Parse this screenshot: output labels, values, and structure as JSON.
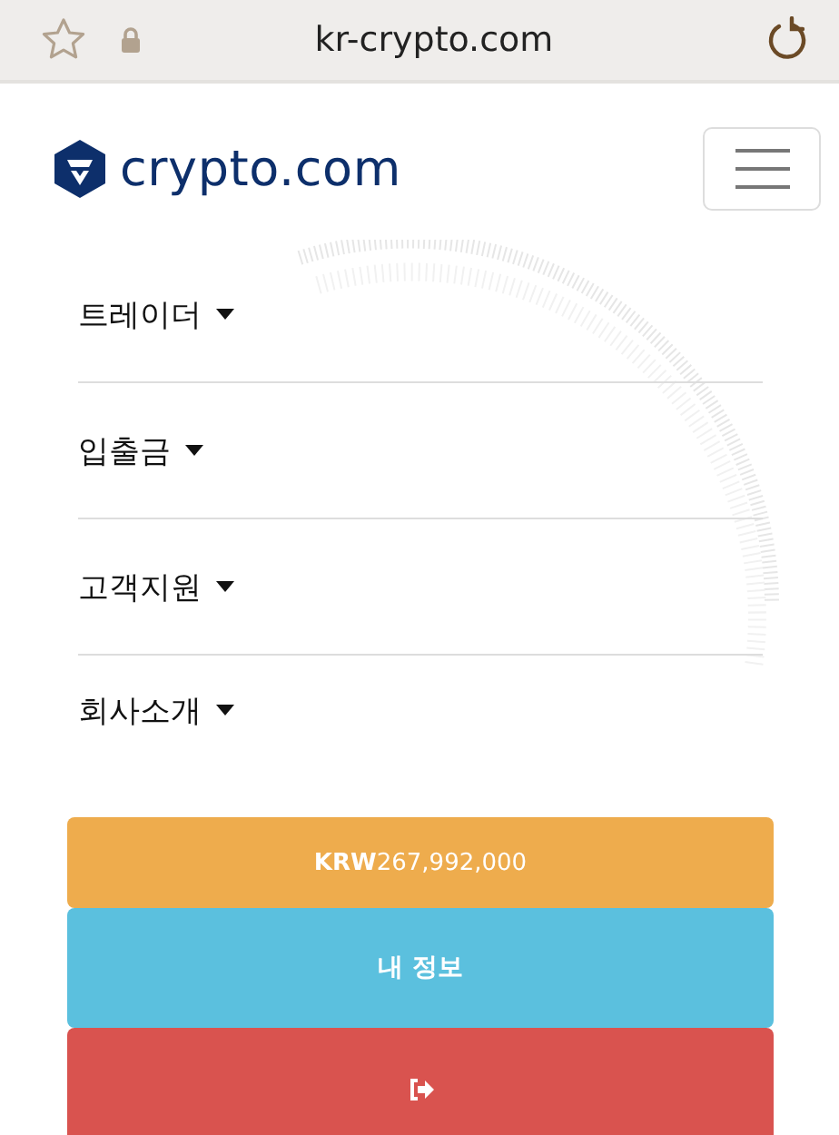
{
  "browser": {
    "url": "kr-crypto.com"
  },
  "header": {
    "logo_text": "crypto.com"
  },
  "menu": [
    {
      "label": "트레이더"
    },
    {
      "label": "입출금"
    },
    {
      "label": "고객지원"
    },
    {
      "label": "회사소개"
    }
  ],
  "buttons": [
    {
      "kind": "balance",
      "label": "**KRW**267,992,000"
    },
    {
      "kind": "profile",
      "label": "내 정보"
    },
    {
      "kind": "logout"
    }
  ]
}
